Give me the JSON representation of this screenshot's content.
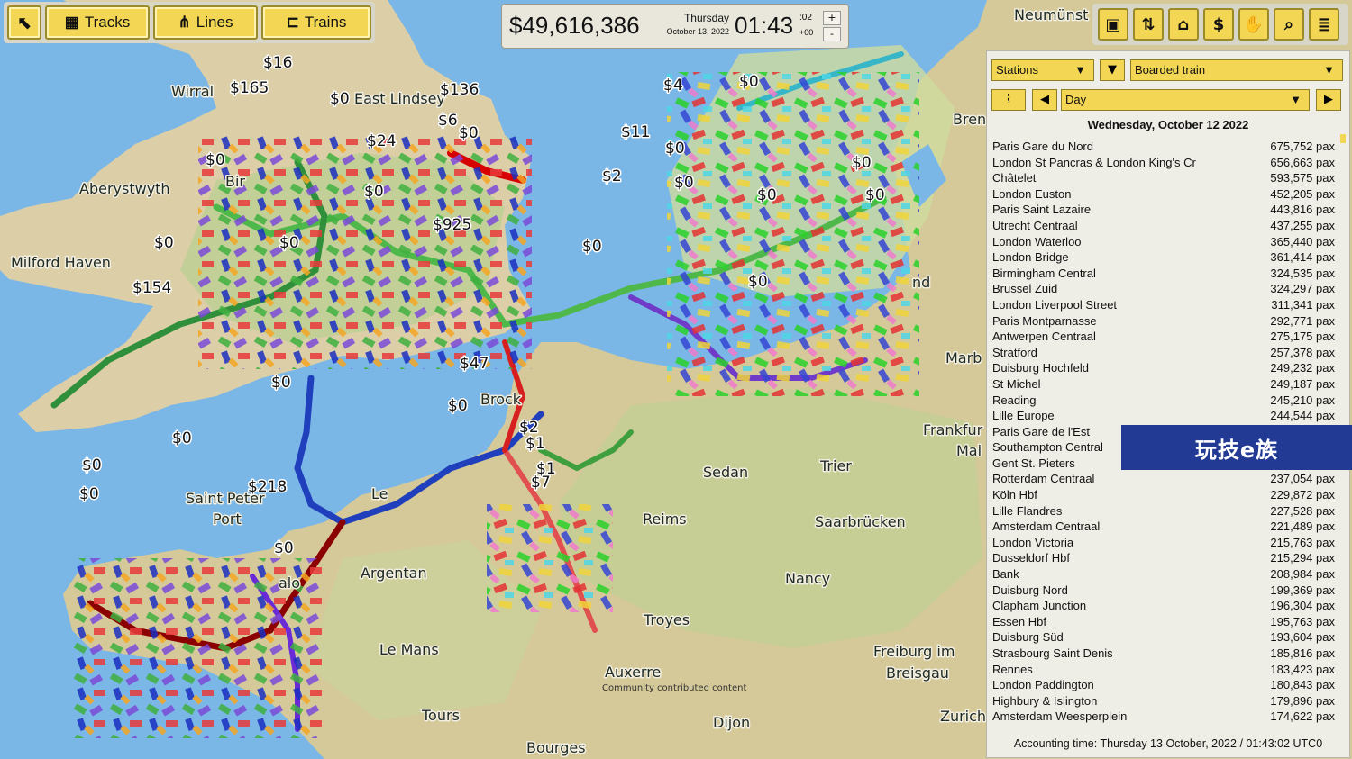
{
  "toolbar": {
    "tracks_label": "Tracks",
    "lines_label": "Lines",
    "trains_label": "Trains"
  },
  "status": {
    "money": "$49,616,386",
    "weekday": "Thursday",
    "date": "October 13, 2022",
    "time": "01:43",
    "seconds": ":02",
    "tz": "+00",
    "plus": "+",
    "minus": "-"
  },
  "right_tools": [
    "map-view-icon",
    "sort-icon",
    "tag-icon",
    "dollar-icon",
    "hand-icon",
    "search-icon",
    "menu-icon"
  ],
  "panel": {
    "category": "Stations",
    "metric": "Boarded train",
    "period": "Day",
    "date": "Wednesday, October 12 2022",
    "accounting": "Accounting time: Thursday 13 October, 2022 / 01:43:02 UTC0",
    "rows": [
      {
        "name": "Paris Gare du Nord",
        "value": "675,752 pax"
      },
      {
        "name": "London St Pancras & London King's Cr",
        "value": "656,663 pax"
      },
      {
        "name": "Châtelet",
        "value": "593,575 pax"
      },
      {
        "name": "London Euston",
        "value": "452,205 pax"
      },
      {
        "name": "Paris Saint Lazaire",
        "value": "443,816 pax"
      },
      {
        "name": "Utrecht Centraal",
        "value": "437,255 pax"
      },
      {
        "name": "London Waterloo",
        "value": "365,440 pax"
      },
      {
        "name": "London Bridge",
        "value": "361,414 pax"
      },
      {
        "name": "Birmingham Central",
        "value": "324,535 pax"
      },
      {
        "name": "Brussel Zuid",
        "value": "324,297 pax"
      },
      {
        "name": "London Liverpool Street",
        "value": "311,341 pax"
      },
      {
        "name": "Paris Montparnasse",
        "value": "292,771 pax"
      },
      {
        "name": "Antwerpen Centraal",
        "value": "275,175 pax"
      },
      {
        "name": "Stratford",
        "value": "257,378 pax"
      },
      {
        "name": "Duisburg Hochfeld",
        "value": "249,232 pax"
      },
      {
        "name": "St Michel",
        "value": "249,187 pax"
      },
      {
        "name": "Reading",
        "value": "245,210 pax"
      },
      {
        "name": "Lille Europe",
        "value": "244,544 pax"
      },
      {
        "name": "Paris Gare de l'Est",
        "value": ""
      },
      {
        "name": "Southampton Central",
        "value": ""
      },
      {
        "name": "Gent St. Pieters",
        "value": ""
      },
      {
        "name": "Rotterdam Centraal",
        "value": "237,054 pax"
      },
      {
        "name": "Köln Hbf",
        "value": "229,872 pax"
      },
      {
        "name": "Lille Flandres",
        "value": "227,528 pax"
      },
      {
        "name": "Amsterdam Centraal",
        "value": "221,489 pax"
      },
      {
        "name": "London Victoria",
        "value": "215,763 pax"
      },
      {
        "name": "Dusseldorf Hbf",
        "value": "215,294 pax"
      },
      {
        "name": "Bank",
        "value": "208,984 pax"
      },
      {
        "name": "Duisburg Nord",
        "value": "199,369 pax"
      },
      {
        "name": "Clapham Junction",
        "value": "196,304 pax"
      },
      {
        "name": "Essen Hbf",
        "value": "195,763 pax"
      },
      {
        "name": "Duisburg Süd",
        "value": "193,604 pax"
      },
      {
        "name": "Strasbourg Saint Denis",
        "value": "185,816 pax"
      },
      {
        "name": "Rennes",
        "value": "183,423 pax"
      },
      {
        "name": "London Paddington",
        "value": "180,843 pax"
      },
      {
        "name": "Highbury & Islington",
        "value": "179,896 pax"
      },
      {
        "name": "Amsterdam Weesperplein",
        "value": "174,622 pax"
      }
    ]
  },
  "map": {
    "places": [
      "Aberystwyth",
      "Milford Haven",
      "Wirral",
      "East Lindsey",
      "Neumünst",
      "Bren",
      "Marb",
      "Frankfur",
      "Mai",
      "Sedan",
      "Trier",
      "Reims",
      "Saarbrücken",
      "Nancy",
      "Troyes",
      "Argentan",
      "Le Mans",
      "Auxerre",
      "Tours",
      "Dijon",
      "Bourges",
      "Freiburg im",
      "Breisgau",
      "Zurich",
      "Saint Peter",
      "Port",
      "Le",
      "Bir",
      "Brock",
      "nd",
      "alo"
    ],
    "money_labels": [
      "$16",
      "$165",
      "$0",
      "$136",
      "$6",
      "$0",
      "$4",
      "$0",
      "$11",
      "$2",
      "$0",
      "$0",
      "$925",
      "$154",
      "$0",
      "$0",
      "$47",
      "$0",
      "$0",
      "$0",
      "$0",
      "$218",
      "$0",
      "$2",
      "$7",
      "$0",
      "$0",
      "$0",
      "$24",
      "$1",
      "$0",
      "$0",
      "$0",
      "$0",
      "$0",
      "$1"
    ],
    "credit": "Community contributed content"
  },
  "watermark": "玩技e族"
}
